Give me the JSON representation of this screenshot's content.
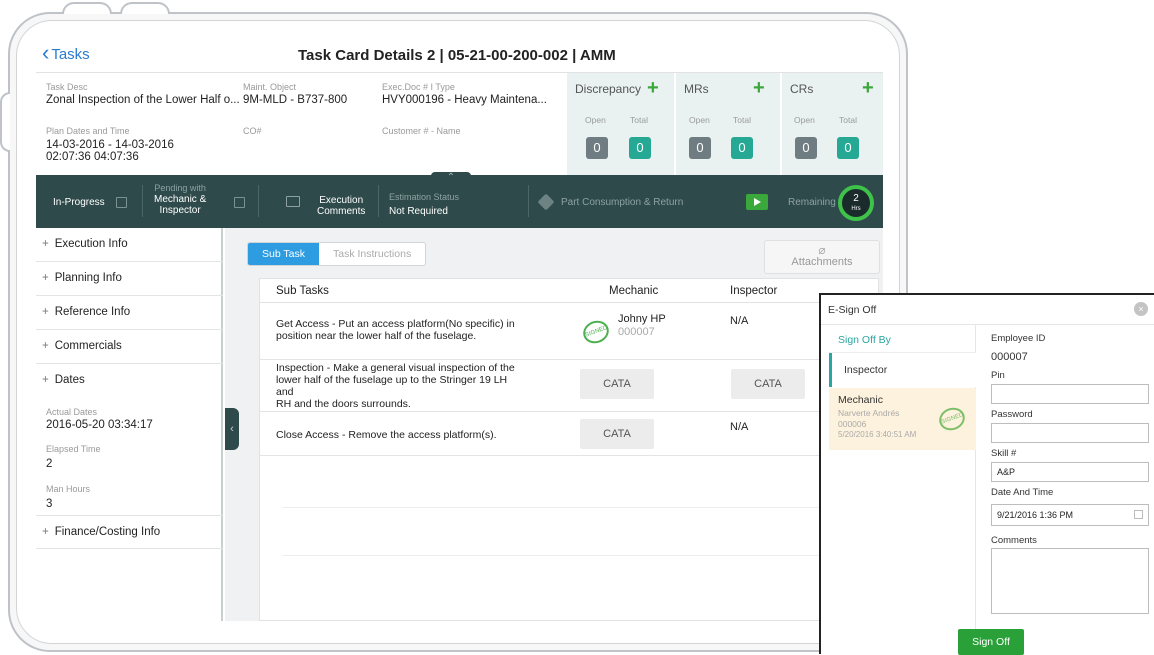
{
  "header": {
    "back_label": "Tasks",
    "title": "Task Card Details  2 | 05-21-00-200-002 | AMM"
  },
  "info": {
    "task_desc_label": "Task Desc",
    "task_desc": "Zonal Inspection of the Lower Half o...",
    "maint_object_label": "Maint. Object",
    "maint_object": "9M-MLD - B737-800",
    "exec_doc_label": "Exec.Doc # I Type",
    "exec_doc": "HVY000196 - Heavy Maintena...",
    "plan_dates_label": "Plan Dates and Time",
    "plan_dates": "14-03-2016 - 14-03-2016",
    "plan_times": "02:07:36      04:07:36",
    "co_label": "CO#",
    "customer_label": "Customer # - Name"
  },
  "counters": [
    {
      "title": "Discrepancy",
      "plus": "+",
      "open_label": "Open",
      "total_label": "Total",
      "open": "0",
      "total": "0"
    },
    {
      "title": "MRs",
      "plus": "+",
      "open_label": "Open",
      "total_label": "Total",
      "open": "0",
      "total": "0"
    },
    {
      "title": "CRs",
      "plus": "+",
      "open_label": "Open",
      "total_label": "Total",
      "open": "0",
      "total": "0"
    }
  ],
  "status_bar": {
    "status": "In-Progress",
    "pending_label": "Pending with",
    "pending_line1": "Mechanic &",
    "pending_line2": "Inspector",
    "exec_comments_line1": "Execution",
    "exec_comments_line2": "Comments",
    "estimation_label": "Estimation Status",
    "estimation_value": "Not Required",
    "part_consumption": "Part Consumption & Return",
    "remaining_label": "Remaining",
    "remaining_value": "2",
    "remaining_unit": "Hrs",
    "pull_glyph": "⌃"
  },
  "sidebar": {
    "items": [
      {
        "label": "Execution Info"
      },
      {
        "label": "Planning Info"
      },
      {
        "label": "Reference Info"
      },
      {
        "label": "Commercials"
      },
      {
        "label": "Dates"
      },
      {
        "label": "Finance/Costing Info"
      }
    ],
    "plus": "+",
    "actual_dates_label": "Actual Dates",
    "actual_dates": "2016-05-20 03:34:17",
    "elapsed_label": "Elapsed Time",
    "elapsed": "2",
    "man_hours_label": "Man Hours",
    "man_hours": "3",
    "handle_glyph": "‹"
  },
  "main": {
    "tabs": [
      {
        "label": "Sub Task"
      },
      {
        "label": "Task Instructions"
      }
    ],
    "attachments_label": "Attachments",
    "columns": {
      "subtasks": "Sub Tasks",
      "mechanic": "Mechanic",
      "inspector": "Inspector"
    },
    "rows": [
      {
        "line1": "Get Access - Put an access platform(No specific) in",
        "line2": "position near the lower half of the fuselage.",
        "mech_name": "Johny HP",
        "mech_id": "000007",
        "inspector": "N/A"
      },
      {
        "line1": "Inspection - Make a general visual inspection of the",
        "line2": "lower half of the fuselage up to the Stringer 19 LH",
        "line3": "and",
        "line4": "RH and the doors surrounds.",
        "mech_btn": "CATA",
        "insp_btn": "CATA"
      },
      {
        "line1": "Close Access - Remove the access platform(s).",
        "mech_btn": "CATA",
        "inspector": "N/A"
      }
    ],
    "stamp_text": "SIGNED"
  },
  "esign": {
    "title": "E-Sign Off",
    "close": "×",
    "sign_off_by": "Sign Off By",
    "inspector": "Inspector",
    "mechanic": "Mechanic",
    "mechanic_name": "Narverte Andrés",
    "mechanic_id": "000006",
    "mechanic_time": "5/20/2016 3:40:51 AM",
    "employee_id_label": "Employee ID",
    "employee_id": "000007",
    "pin_label": "Pin",
    "password_label": "Password",
    "skill_label": "Skill #",
    "skill": "A&P",
    "datetime_label": "Date And Time",
    "datetime": "9/21/2016   1:36 PM",
    "comments_label": "Comments",
    "sign_button": "Sign Off"
  },
  "colors": {
    "accent_blue": "#2b7bd0",
    "status_bar": "#2f4a4b",
    "green": "#3aa83a",
    "teal": "#25a894"
  }
}
